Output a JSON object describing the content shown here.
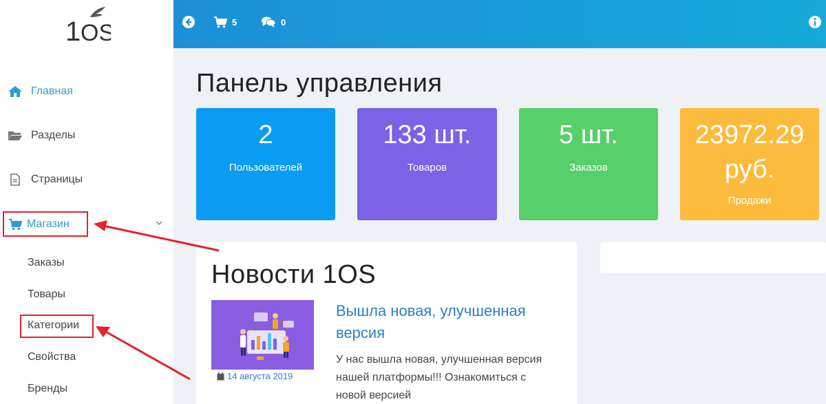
{
  "logo": {
    "text": "1OS"
  },
  "topbar": {
    "cart_count": "5",
    "messages_count": "0",
    "icons": [
      "back-arrow-icon",
      "cart-icon",
      "chat-icon",
      "info-icon"
    ]
  },
  "sidebar": {
    "items": [
      {
        "label": "Главная",
        "icon": "home-icon"
      },
      {
        "label": "Разделы",
        "icon": "folder-icon"
      },
      {
        "label": "Страницы",
        "icon": "document-icon"
      },
      {
        "label": "Магазин",
        "icon": "cart-icon"
      }
    ],
    "shop_sub": [
      {
        "label": "Заказы"
      },
      {
        "label": "Товары"
      },
      {
        "label": "Категории"
      },
      {
        "label": "Свойства"
      },
      {
        "label": "Бренды"
      }
    ]
  },
  "dashboard": {
    "title": "Панель управления",
    "stats": [
      {
        "value": "2",
        "label": "Пользователей",
        "color": "#0a9cf2"
      },
      {
        "value": "133 шт.",
        "label": "Товаров",
        "color": "#7b62e6"
      },
      {
        "value": "5 шт.",
        "label": "Заказов",
        "color": "#57cf6a"
      },
      {
        "value": "23972.29",
        "value2": "руб.",
        "label": "Продажи",
        "color": "#fbbb3d"
      }
    ]
  },
  "news": {
    "title": "Новости 1OS",
    "headline": "Вышла новая, улучшенная версия",
    "date": "14 августа 2019",
    "text": "У нас вышла новая, улучшенная версия нашей платформы!!! Ознакомиться с новой версией"
  },
  "colors": {
    "accent": "#2a9cdb",
    "highlight": "#e8202a"
  }
}
